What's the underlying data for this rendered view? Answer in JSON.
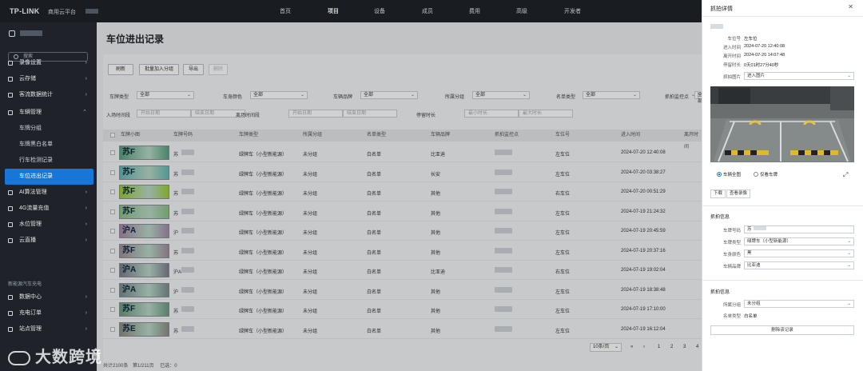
{
  "header": {
    "brand": "TP-LINK",
    "brand_sub": "商用云平台",
    "nav": [
      "首页",
      "项目",
      "设备",
      "成员",
      "费用",
      "高级",
      "开发者"
    ],
    "active_nav": "项目"
  },
  "sidebar": {
    "search_placeholder": "搜索",
    "items": [
      {
        "label": "录像设置",
        "type": "top"
      },
      {
        "label": "云存储",
        "type": "top"
      },
      {
        "label": "客流数据统计",
        "type": "top"
      },
      {
        "label": "车辆管理",
        "type": "top-open"
      },
      {
        "label": "车牌分组",
        "type": "sub"
      },
      {
        "label": "车牌黑白名单",
        "type": "sub"
      },
      {
        "label": "行车检测记录",
        "type": "sub"
      },
      {
        "label": "车位进出记录",
        "type": "sub-active"
      },
      {
        "label": "AI算法管理",
        "type": "top"
      },
      {
        "label": "4G流量充值",
        "type": "top"
      },
      {
        "label": "水位管理",
        "type": "top"
      },
      {
        "label": "云直播",
        "type": "top"
      }
    ],
    "section2": "新能源汽车充电",
    "items2": [
      {
        "label": "数据中心"
      },
      {
        "label": "充电订单"
      },
      {
        "label": "站点管理"
      }
    ]
  },
  "watermark": "大数跨境",
  "page": {
    "title": "车位进出记录",
    "toolbar": [
      "刷新",
      "批量加入分组",
      "导出",
      "删除"
    ]
  },
  "filters": {
    "row1": [
      {
        "label": "车牌类型",
        "value": "全部"
      },
      {
        "label": "车身颜色",
        "value": "全部"
      },
      {
        "label": "车辆品牌",
        "value": "全部"
      },
      {
        "label": "所属分组",
        "value": "全部"
      },
      {
        "label": "名单类型",
        "value": "全部"
      },
      {
        "label": "抓拍监控点",
        "value": "全部"
      }
    ],
    "row2": [
      {
        "label": "入场时间段",
        "start": "开始日期",
        "end": "结束日期"
      },
      {
        "label": "离场时间段",
        "start": "开始日期",
        "end": "结束日期"
      },
      {
        "label": "停留时长",
        "start": "最小时长",
        "end": "最大时长"
      }
    ]
  },
  "table": {
    "columns": [
      "车牌小图",
      "车牌号码",
      "车牌类型",
      "所属分组",
      "名单类型",
      "车辆品牌",
      "抓拍监控点",
      "车位号",
      "进入时间",
      "离开时间"
    ],
    "rows": [
      {
        "plate": "苏F",
        "number": "苏",
        "ptype": "绿牌车（小型新能源）",
        "group": "未分组",
        "list": "白名单",
        "brand": "比亚迪",
        "spot": "左车位",
        "time": "2024-07-20 12:40:08",
        "pcolor": "#5aa07f"
      },
      {
        "plate": "苏F",
        "number": "苏",
        "ptype": "绿牌车（小型新能源）",
        "group": "未分组",
        "list": "白名单",
        "brand": "长安",
        "spot": "左车位",
        "time": "2024-07-20 03:38:27",
        "pcolor": "#66b8b4"
      },
      {
        "plate": "苏F",
        "number": "苏",
        "ptype": "绿牌车（小型新能源）",
        "group": "未分组",
        "list": "白名单",
        "brand": "其他",
        "spot": "右车位",
        "time": "2024-07-20 00:51:29",
        "pcolor": "#9ccd3a"
      },
      {
        "plate": "苏F",
        "number": "苏",
        "ptype": "绿牌车（小型新能源）",
        "group": "未分组",
        "list": "白名单",
        "brand": "其他",
        "spot": "左车位",
        "time": "2024-07-19 21:24:32",
        "pcolor": "#8dbf86"
      },
      {
        "plate": "沪A",
        "number": "沪",
        "ptype": "绿牌车（小型新能源）",
        "group": "未分组",
        "list": "白名单",
        "brand": "其他",
        "spot": "左车位",
        "time": "2024-07-19 20:45:59",
        "pcolor": "#a58aa8"
      },
      {
        "plate": "苏F",
        "number": "苏",
        "ptype": "绿牌车（小型新能源）",
        "group": "未分组",
        "list": "白名单",
        "brand": "其他",
        "spot": "左车位",
        "time": "2024-07-19 20:37:16",
        "pcolor": "#9f8f9c"
      },
      {
        "plate": "沪A",
        "number": "沪A",
        "ptype": "绿牌车（小型新能源）",
        "group": "未分组",
        "list": "白名单",
        "brand": "比亚迪",
        "spot": "右车位",
        "time": "2024-07-19 19:02:04",
        "pcolor": "#7d7f8c"
      },
      {
        "plate": "沪A",
        "number": "沪",
        "ptype": "绿牌车（小型新能源）",
        "group": "未分组",
        "list": "白名单",
        "brand": "其他",
        "spot": "左车位",
        "time": "2024-07-19 18:38:48",
        "pcolor": "#7b8d90"
      },
      {
        "plate": "苏F",
        "number": "苏",
        "ptype": "绿牌车（小型新能源）",
        "group": "未分组",
        "list": "白名单",
        "brand": "其他",
        "spot": "左车位",
        "time": "2024-07-19 17:10:00",
        "pcolor": "#6e9a82"
      },
      {
        "plate": "苏E",
        "number": "苏",
        "ptype": "绿牌车（小型新能源）",
        "group": "未分组",
        "list": "白名单",
        "brand": "其他",
        "spot": "左车位",
        "time": "2024-07-19 16:12:04",
        "pcolor": "#8c8f86"
      }
    ]
  },
  "pager": {
    "summary": "共计2100条",
    "page_info": "第1/211页",
    "selected": "已选：0",
    "page_size": "10条/页",
    "pages": [
      "1",
      "2",
      "3",
      "4"
    ]
  },
  "drawer": {
    "title": "抓拍详情",
    "info": [
      {
        "label": "车位号",
        "value": "左车位"
      },
      {
        "label": "进入时间",
        "value": "2024-07-20 12:40:08"
      },
      {
        "label": "离开时间",
        "value": "2024-07-20 14:07:48"
      },
      {
        "label": "停留时长",
        "value": "0天01时27分40秒"
      }
    ],
    "photo_label": "抓拍图片",
    "photo_value": "进入图片",
    "radio1": "车辆全图",
    "radio2": "仅看车牌",
    "btn_download": "下载",
    "btn_record": "查看录像",
    "section1": "抓拍信息",
    "capture": [
      {
        "label": "车牌号码",
        "value": "苏",
        "kind": "input"
      },
      {
        "label": "车牌类型",
        "value": "绿牌车（小型新能源）",
        "kind": "select"
      },
      {
        "label": "车身颜色",
        "value": "黑",
        "kind": "select"
      },
      {
        "label": "车辆品牌",
        "value": "比亚迪",
        "kind": "select"
      }
    ],
    "section2": "抓拍信息",
    "group_label": "所属分组",
    "group_value": "未分组",
    "list_label": "名单类型",
    "list_value": "白名单",
    "btn_delete": "删除该记录"
  }
}
